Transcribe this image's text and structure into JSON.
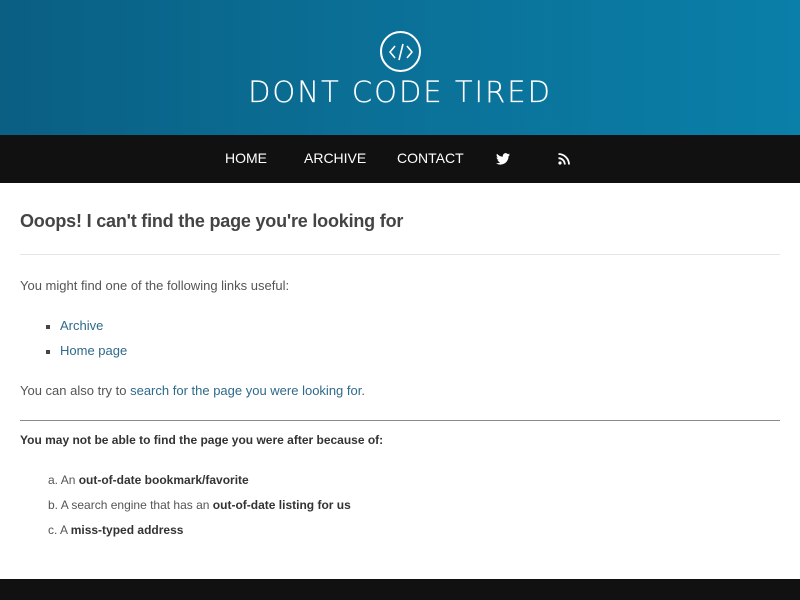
{
  "header": {
    "site_title": "DONT CODE TIRED"
  },
  "nav": {
    "home": "HOME",
    "archive": "ARCHIVE",
    "contact": "CONTACT",
    "icons": [
      "twitter-icon",
      "rss-icon"
    ]
  },
  "main": {
    "title": "Ooops! I can't find the page you're looking for",
    "intro": "You might find one of the following links useful:",
    "links": [
      "Archive",
      "Home page"
    ],
    "search_prefix": "You can also try to ",
    "search_link": "search for the page you were looking for",
    "search_suffix": ".",
    "reasons_title": "You may not be able to find the page you were after because of:",
    "reasons": [
      {
        "marker": "a.",
        "prefix": "An ",
        "bold": "out-of-date bookmark/favorite"
      },
      {
        "marker": "b.",
        "prefix": "A search engine that has an ",
        "bold": "out-of-date listing for us"
      },
      {
        "marker": "c.",
        "prefix": "A ",
        "bold": "miss-typed address"
      }
    ]
  },
  "colors": {
    "header_bg": "#0b6f96",
    "nav_bg": "#111111",
    "link": "#2e6a8a"
  }
}
